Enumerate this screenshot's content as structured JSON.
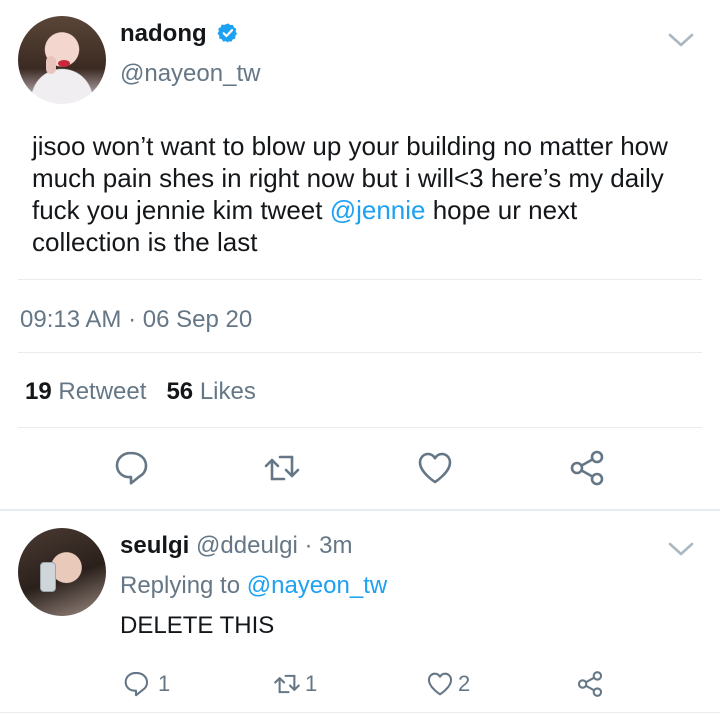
{
  "tweet": {
    "display_name": "nadong",
    "handle": "@nayeon_tw",
    "body_parts": [
      "jisoo won’t want to blow up your building no matter how much pain shes in right now but i will<3 here’s my daily fuck you jennie kim tweet ",
      "@jennie",
      " hope ur next collection is the last"
    ],
    "timestamp": "09:13 AM · 06 Sep 20",
    "retweet_count": "19",
    "retweet_label": "Retweet",
    "likes_count": "56",
    "likes_label": "Likes",
    "verified_color": "#1da1f2"
  },
  "reply": {
    "display_name": "seulgi",
    "handle": "@ddeulgi",
    "time": "· 3m",
    "replying_prefix": "Replying to",
    "replying_to": "@nayeon_tw",
    "text": "DELETE THIS",
    "reply_count": "1",
    "retweet_count": "1",
    "like_count": "2"
  },
  "icons": [
    "chevron-down-icon",
    "reply-icon",
    "retweet-icon",
    "like-icon",
    "share-icon",
    "verified-badge-icon"
  ],
  "colors": {
    "accent": "#1da1f2",
    "secondary_text": "#657786",
    "primary_text": "#14171a",
    "divider": "#e6ecf0"
  }
}
